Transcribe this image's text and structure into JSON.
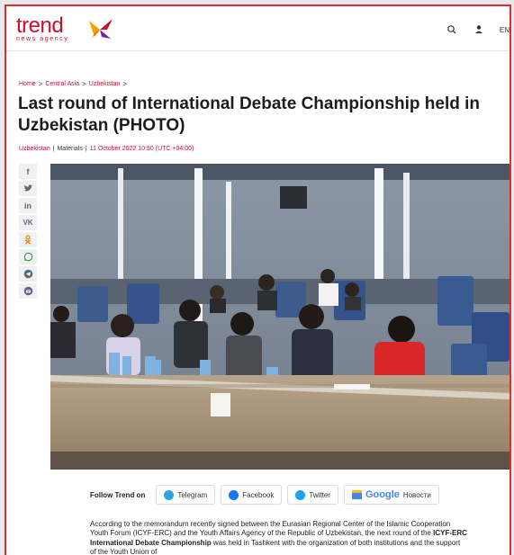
{
  "header": {
    "logo_word": "trend",
    "logo_sub": "news agency",
    "lang": "EN",
    "search_icon": "search-icon",
    "user_icon": "user-icon"
  },
  "breadcrumb": {
    "items": [
      "Home",
      "Central Asia",
      "Uzbekistan"
    ],
    "sep": ">"
  },
  "article": {
    "title": "Last round of International Debate Championship held in Uzbekistan (PHOTO)",
    "category": "Uzbekistan",
    "section": "Materials",
    "date": "11 October 2022 10:50 (UTC +04:00)",
    "meta_sep": "|"
  },
  "share": [
    "f",
    "twitter-icon",
    "in",
    "vk-icon",
    "ok-icon",
    "whatsapp-icon",
    "telegram-icon",
    "email-icon"
  ],
  "follow": {
    "label": "Follow Trend on",
    "channels": [
      {
        "name": "Telegram",
        "color": "#2aa3de"
      },
      {
        "name": "Facebook",
        "color": "#1877f2"
      },
      {
        "name": "Twitter",
        "color": "#1da1f2"
      },
      {
        "name_prefix": "Google",
        "name": "Новости",
        "color": "#4285f4"
      }
    ]
  },
  "body": {
    "p1_a": "According to the memorandum recently signed between the Eurasian Regional Center of the Islamic Cooperation Youth Forum (ICYF-ERC) and the Youth Affairs Agency of the Republic of Uzbekistan, the next round of the ",
    "p1_bold": "ICYF-ERC International Debate Championship",
    "p1_b": " was held in Tashkent with the organization of both institutions and the support of the Youth Union of"
  },
  "colors": {
    "brand": "#c8102e",
    "frame": "#d9322c"
  }
}
